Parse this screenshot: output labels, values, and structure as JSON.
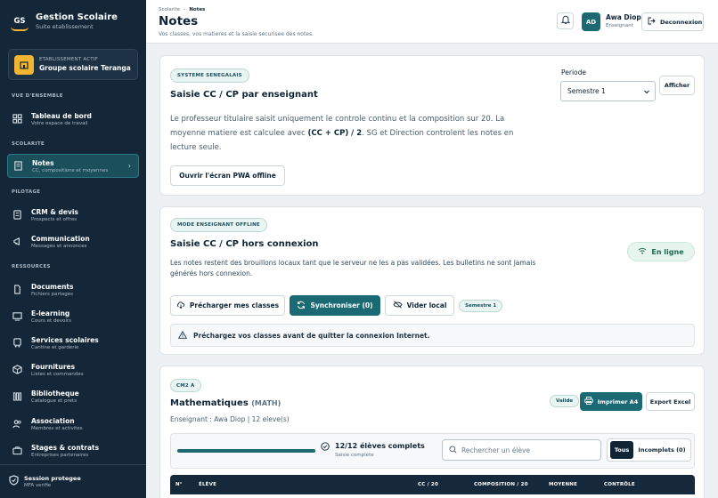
{
  "brand": {
    "logo": "GS",
    "title": "Gestion Scolaire",
    "subtitle": "Suite etablissement"
  },
  "establishment": {
    "label": "ETABLISSEMENT ACTIF",
    "name": "Groupe scolaire Teranga"
  },
  "nav": {
    "sections": [
      "VUE D'ENSEMBLE",
      "SCOLARITE",
      "PILOTAGE",
      "RESSOURCES"
    ],
    "items": [
      {
        "title": "Tableau de bord",
        "sub": "Votre espace de travail",
        "icon": "grid-icon"
      },
      {
        "title": "Notes",
        "sub": "CC, compositions et moyennes",
        "icon": "notes-icon"
      },
      {
        "title": "CRM & devis",
        "sub": "Prospects et offres",
        "icon": "crm-icon"
      },
      {
        "title": "Communication",
        "sub": "Messages et annonces",
        "icon": "megaphone-icon"
      },
      {
        "title": "Documents",
        "sub": "Fichiers partages",
        "icon": "documents-icon"
      },
      {
        "title": "E-learning",
        "sub": "Cours et devoirs",
        "icon": "elearning-icon"
      },
      {
        "title": "Services scolaires",
        "sub": "Cantine et garderie",
        "icon": "bus-icon"
      },
      {
        "title": "Fournitures",
        "sub": "Listes et commandes",
        "icon": "box-icon"
      },
      {
        "title": "Bibliotheque",
        "sub": "Catalogue et prets",
        "icon": "library-icon"
      },
      {
        "title": "Association",
        "sub": "Membres et activites",
        "icon": "users-icon"
      },
      {
        "title": "Stages & contrats",
        "sub": "Entreprises partenaires",
        "icon": "briefcase-icon"
      }
    ]
  },
  "session": {
    "title": "Session protegee",
    "sub": "MFA verifie"
  },
  "header": {
    "breadcrumb_root": "Scolarite",
    "breadcrumb_current": "Notes",
    "title": "Notes",
    "subtitle": "Vos classes, vos matieres et la saisie securisee des notes.",
    "avatar": "AD",
    "user_name": "Awa Diop",
    "user_role": "Enseignant",
    "logout": "Deconnexion"
  },
  "card1": {
    "pill": "SYSTEME SENEGALAIS",
    "title": "Saisie CC / CP par enseignant",
    "period_label": "Periode",
    "period_value": "Semestre 1",
    "show_button": "Afficher",
    "text_1": "Le professeur titulaire saisit uniquement le controle continu et la composition sur 20. La",
    "text_2a": "moyenne matiere est calculee avec ",
    "text_2b": "(CC + CP) / 2",
    "text_2c": ". SG et Direction controlent les notes en",
    "text_3": "lecture seule.",
    "pwa_button": "Ouvrir l'écran PWA offline"
  },
  "card2": {
    "pill": "MODE ENSEIGNANT OFFLINE",
    "title": "Saisie CC / CP hors connexion",
    "status": "En ligne",
    "text": "Les notes restent des brouillons locaux tant que le serveur ne les a pas validées. Les bulletins ne sont jamais générés hors connexion.",
    "preload_button": "Précharger mes classes",
    "sync_button": "Synchroniser (0)",
    "clear_button": "Vider local",
    "semester_pill": "Semestre 1",
    "alert": "Préchargez vos classes avant de quitter la connexion Internet."
  },
  "card3": {
    "class_pill": "CM2 A",
    "subject": "Mathematiques",
    "subject_code": "(MATH)",
    "teacher": "Enseignant : Awa Diop | 12 eleve(s)",
    "status_pill": "Valide",
    "print_button": "Imprimer A4",
    "export_button": "Export Excel",
    "progress": 1.0,
    "progress_text": "12/12 élèves complets",
    "progress_sub": "Saisie complète",
    "search_placeholder": "Rechercher un élève",
    "filter_all": "Tous",
    "filter_incomplete": "Incomplets (0)",
    "columns": [
      "N°",
      "ÉLÈVE",
      "CC / 20",
      "COMPOSITION / 20",
      "MOYENNE",
      "CONTRÔLE"
    ]
  },
  "colors": {
    "sidebar": "#142738",
    "accent": "#1b6a73",
    "gold": "#f2b531"
  }
}
